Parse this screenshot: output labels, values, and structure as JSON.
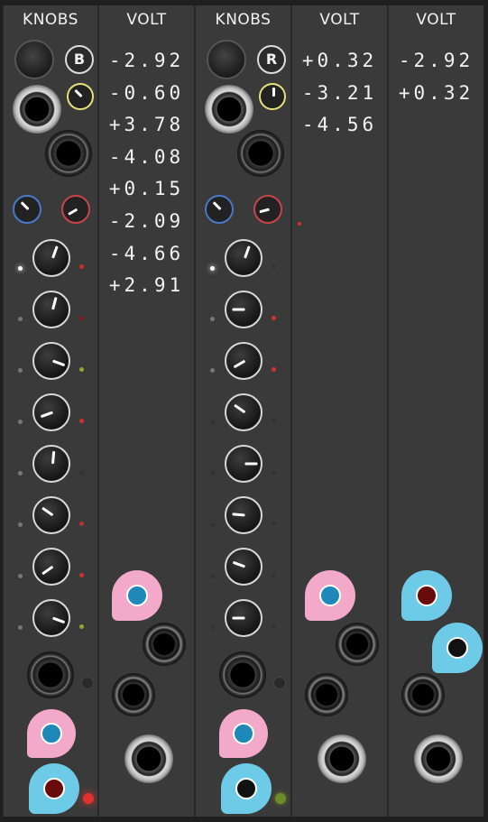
{
  "panels": [
    {
      "title": "KNOBS",
      "button_letter": "B"
    },
    {
      "title": "VOLT",
      "values": [
        "-2.92",
        "-0.60",
        "+3.78",
        "-4.08",
        "+0.15",
        "-2.09",
        "-4.66",
        "+2.91"
      ]
    },
    {
      "title": "KNOBS",
      "button_letter": "R"
    },
    {
      "title": "VOLT",
      "values": [
        "+0.32",
        "-3.21",
        "-4.56"
      ]
    },
    {
      "title": "VOLT",
      "values": [
        "-2.92",
        "+0.32"
      ]
    }
  ],
  "colors": {
    "panel": "#3a3a3a",
    "plug_pink": "#f3a9c9",
    "plug_cyan": "#6ecbe8",
    "jack_blue": "#1e88b8",
    "jack_red": "#6a0b0b",
    "led_red": "#e03030",
    "led_green": "#7fbf3a"
  },
  "icons": [
    "knob-icon",
    "jack-icon",
    "led-icon",
    "cable-plug-icon"
  ]
}
